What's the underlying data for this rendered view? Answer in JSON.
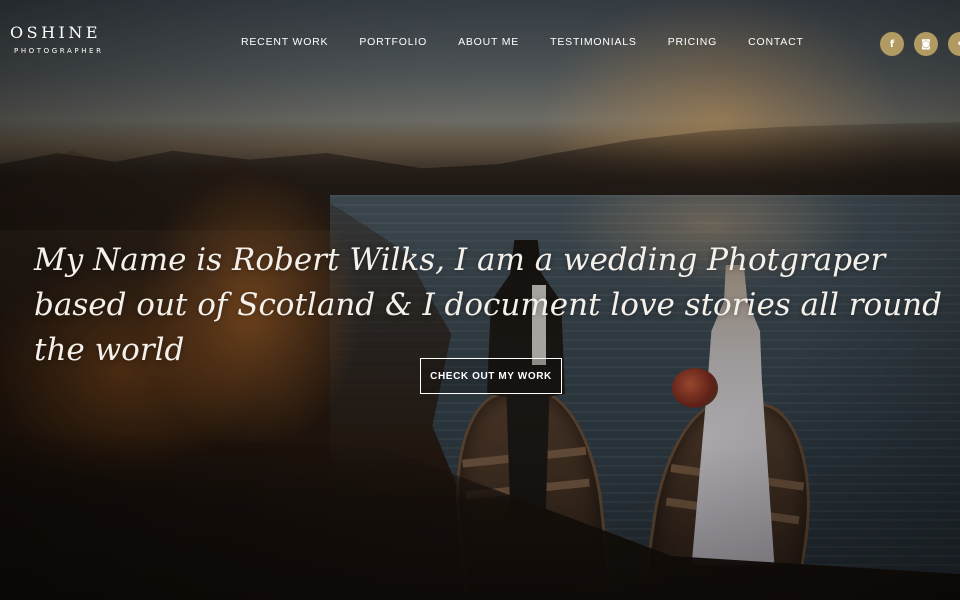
{
  "brand": {
    "name": "OSHINE",
    "tagline": "PHOTOGRAPHER"
  },
  "nav": {
    "items": [
      {
        "label": "RECENT WORK"
      },
      {
        "label": "PORTFOLIO"
      },
      {
        "label": "ABOUT ME"
      },
      {
        "label": "TESTIMONIALS"
      },
      {
        "label": "PRICING"
      },
      {
        "label": "CONTACT"
      }
    ]
  },
  "socials": [
    {
      "icon": "facebook-icon",
      "glyph": "f"
    },
    {
      "icon": "instagram-icon",
      "glyph": "◙"
    },
    {
      "icon": "flickr-icon",
      "glyph": "•"
    }
  ],
  "hero": {
    "headline": "My Name is Robert Wilks, I am a wedding Photgraper based out of Scotland & I document love stories all round the world",
    "cta_label": "CHECK OUT MY WORK"
  },
  "colors": {
    "accent": "#b29b63",
    "text": "#ffffff"
  }
}
